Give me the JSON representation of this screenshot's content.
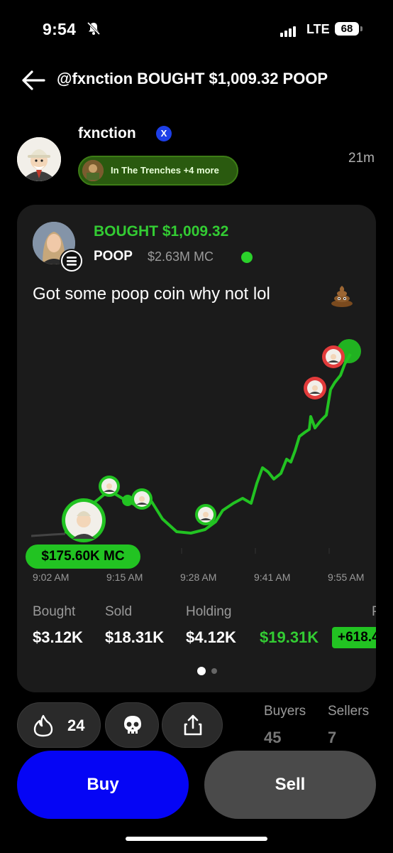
{
  "status_bar": {
    "time": "9:54",
    "network": "LTE",
    "battery": "68"
  },
  "header": {
    "title": "@fxnction BOUGHT $1,009.32 POOP"
  },
  "profile": {
    "username": "fxnction",
    "x_badge": "X",
    "pill_text": "In The Trenches +4 more",
    "time_ago": "21m"
  },
  "trade_card": {
    "action_label": "BOUGHT $1,009.32",
    "ticker": "POOP",
    "market_cap": "$2.63M MC",
    "comment": "Got some poop coin why not lol",
    "entry_mc_label": "$175.60K MC",
    "x_ticks": [
      "9:02 AM",
      "9:15 AM",
      "9:28 AM",
      "9:41 AM",
      "9:55 AM"
    ],
    "stats": {
      "bought_label": "Bought",
      "bought_value": "$3.12K",
      "sold_label": "Sold",
      "sold_value": "$18.31K",
      "holding_label": "Holding",
      "holding_value": "$4.12K",
      "pnl_value": "$19.31K",
      "pnl_pct": "+618.4",
      "partial_label": "P"
    },
    "page_index": 1,
    "page_count": 2
  },
  "actions": {
    "fire_count": "24",
    "fire_icon": "fire-icon",
    "skull_icon": "skull-icon",
    "share_icon": "share-icon",
    "buyers_label": "Buyers",
    "buyers_value": "45",
    "sellers_label": "Sellers",
    "sellers_value": "7"
  },
  "buttons": {
    "buy": "Buy",
    "sell": "Sell"
  },
  "colors": {
    "accent_green": "#33cc33",
    "buy_blue": "#0505f5",
    "sell_red": "#e23b3b"
  }
}
